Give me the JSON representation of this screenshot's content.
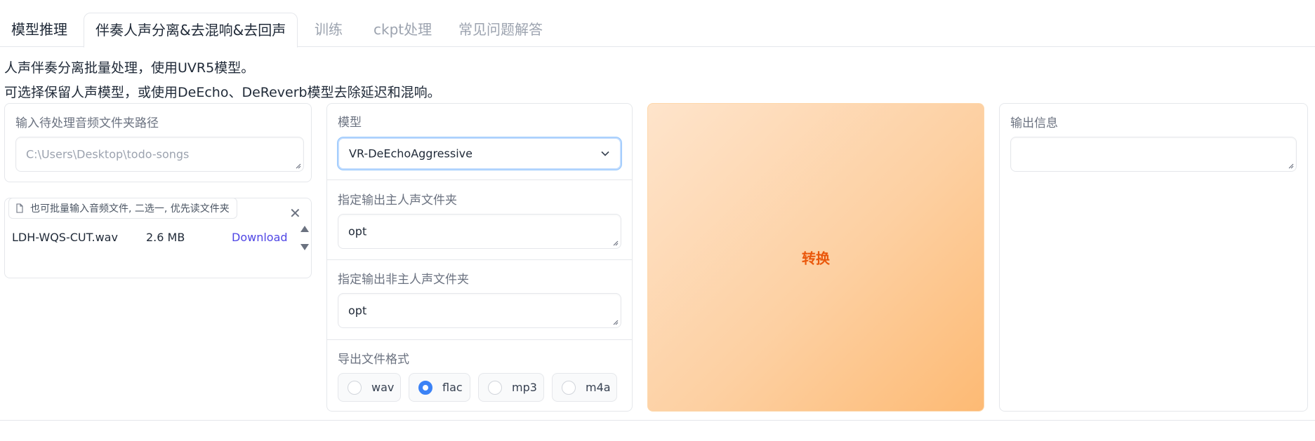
{
  "tabs": [
    {
      "label": "模型推理"
    },
    {
      "label": "伴奏人声分离&去混响&去回声"
    },
    {
      "label": "训练"
    },
    {
      "label": "ckpt处理"
    },
    {
      "label": "常见问题解答"
    }
  ],
  "description": {
    "line1": "人声伴奏分离批量处理，使用UVR5模型。",
    "line2": "可选择保留人声模型，或使用DeEcho、DeReverb模型去除延迟和混响。"
  },
  "input_folder": {
    "label": "输入待处理音频文件夹路径",
    "placeholder": "C:\\Users\\Desktop\\todo-songs",
    "value": ""
  },
  "file_upload": {
    "label": "也可批量输入音频文件, 二选一, 优先读文件夹",
    "files": [
      {
        "name": "LDH-WQS-CUT.wav",
        "size": "2.6 MB",
        "download": "Download"
      }
    ]
  },
  "model": {
    "label": "模型",
    "selected": "VR-DeEchoAggressive"
  },
  "vocal_output": {
    "label": "指定输出主人声文件夹",
    "value": "opt"
  },
  "instrumental_output": {
    "label": "指定输出非主人声文件夹",
    "value": "opt"
  },
  "export_format": {
    "label": "导出文件格式",
    "options": [
      "wav",
      "flac",
      "mp3",
      "m4a"
    ],
    "selected": "flac"
  },
  "convert_button": {
    "label": "转换"
  },
  "output_info": {
    "label": "输出信息",
    "value": ""
  },
  "colors": {
    "accent": "#3b82f6",
    "convert_text": "#ea580c",
    "link": "#4f46e5"
  }
}
